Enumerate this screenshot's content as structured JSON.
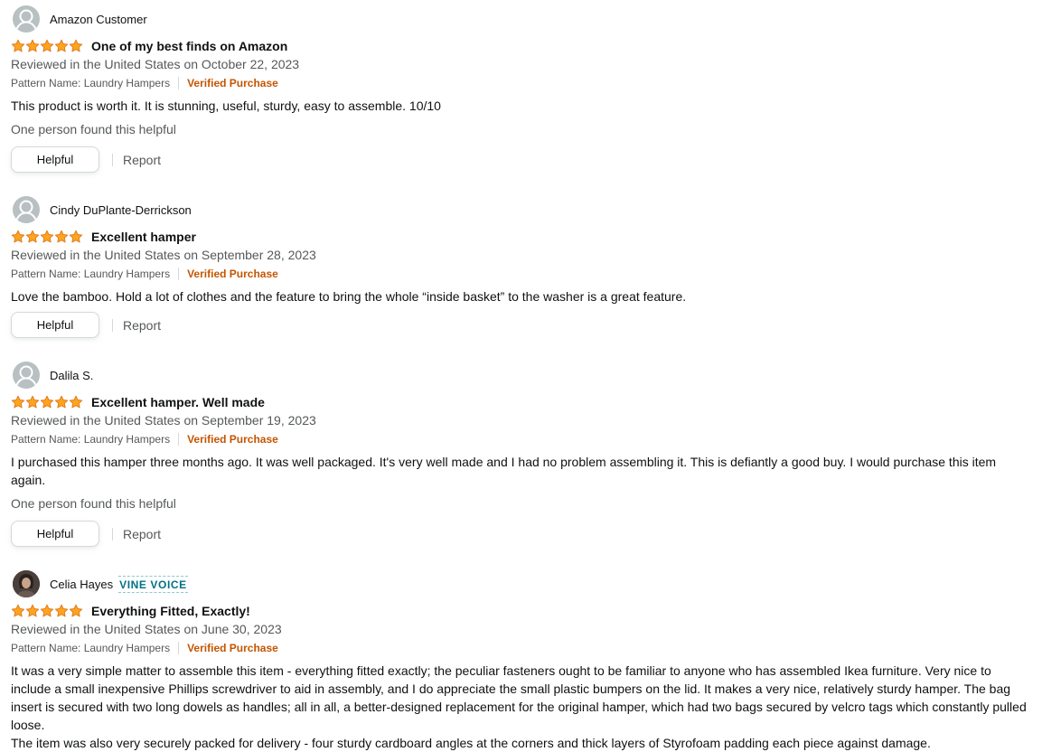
{
  "reviews": [
    {
      "author": "Amazon Customer",
      "avatar": "default-avatar",
      "badge": "",
      "rating": 5,
      "title": "One of my best finds on Amazon",
      "date": "Reviewed in the United States on October 22, 2023",
      "pattern": "Pattern Name: Laundry Hampers",
      "verified": "Verified Purchase",
      "body": "This product is worth it. It is stunning, useful, sturdy, easy to assemble. 10/10",
      "helpful_count": "One person found this helpful",
      "helpful_label": "Helpful",
      "report_label": "Report"
    },
    {
      "author": "Cindy DuPlante-Derrickson",
      "avatar": "default-avatar",
      "badge": "",
      "rating": 5,
      "title": "Excellent hamper",
      "date": "Reviewed in the United States on September 28, 2023",
      "pattern": "Pattern Name: Laundry Hampers",
      "verified": "Verified Purchase",
      "body": "Love the bamboo. Hold a lot of clothes and the feature to bring the whole “inside basket” to the washer is a great feature.",
      "helpful_count": "",
      "helpful_label": "Helpful",
      "report_label": "Report"
    },
    {
      "author": "Dalila S.",
      "avatar": "default-avatar",
      "badge": "",
      "rating": 5,
      "title": "Excellent hamper. Well made",
      "date": "Reviewed in the United States on September 19, 2023",
      "pattern": "Pattern Name: Laundry Hampers",
      "verified": "Verified Purchase",
      "body": "I purchased this hamper three months ago. It was well packaged. It's very well made and I had no problem assembling it. This is defiantly a good buy. I would purchase this item again.",
      "helpful_count": "One person found this helpful",
      "helpful_label": "Helpful",
      "report_label": "Report"
    },
    {
      "author": "Celia Hayes",
      "avatar": "photo-avatar",
      "badge": "VINE VOICE",
      "rating": 5,
      "title": "Everything Fitted, Exactly!",
      "date": "Reviewed in the United States on June 30, 2023",
      "pattern": "Pattern Name: Laundry Hampers",
      "verified": "Verified Purchase",
      "body": "It was a very simple matter to assemble this item - everything fitted exactly; the peculiar fasteners ought to be familiar to anyone who has assembled Ikea furniture. Very nice to include a small inexpensive Phillips screwdriver to aid in assembly, and I do appreciate the small plastic bumpers on the lid. It makes a very nice, relatively sturdy hamper. The bag insert is secured with two long dowels as handles; all in all, a better-designed replacement for the original hamper, which had two bags secured by velcro tags which constantly pulled loose.",
      "body2": "The item was also very securely packed for delivery - four sturdy cardboard angles at the corners and thick layers of Styrofoam padding each piece against damage.",
      "helpful_count": "",
      "helpful_label": "",
      "report_label": ""
    }
  ],
  "colors": {
    "star": "#ffa41c",
    "star_stroke": "#de7921",
    "verified": "#c45500",
    "vine": "#007185",
    "muted_text": "#565959"
  }
}
